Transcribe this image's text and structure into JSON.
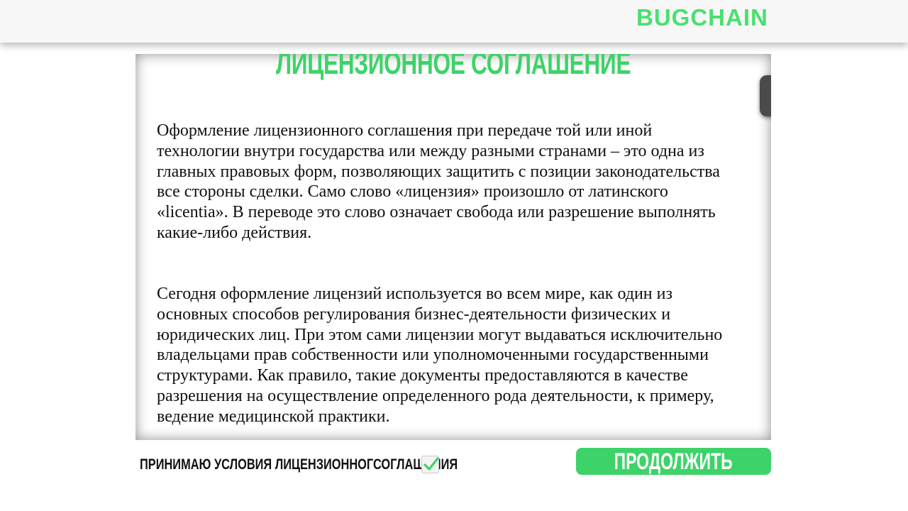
{
  "header": {
    "logo": "BUGCHAIN"
  },
  "document": {
    "title": "ЛИЦЕНЗИОННОЕ СОГЛАШЕНИЕ",
    "paragraphs": [
      "Оформление лицензионного соглашения при передаче той или иной технологии внутри государства или между разными странами – это одна из главных правовых форм, позволяющих защитить с позиции законодательства все стороны сделки. Само слово «лицензия» произошло от латинского «licentia». В переводе это слово означает свобода или разрешение выполнять какие-либо действия.",
      "Сегодня оформление лицензий используется во всем мире, как один из основных способов регулирования бизнес-деятельности физических и юридических лиц. При этом сами лицензии могут выдаваться исключительно владельцами прав собственности или уполномоченными государственными структурами. Как правило, такие документы предоставляются в качестве разрешения на осуществление определенного рода деятельности, к примеру, ведение медицинской практики."
    ]
  },
  "footer": {
    "accept_label": "ПРИНИМАЮ УСЛОВИЯ ЛИЦЕНЗИОННОГСОГЛАШЕНИЯ",
    "accept_checked": true,
    "continue_label": "ПРОДОЛЖИТЬ"
  },
  "colors": {
    "accent": "#3dd368",
    "logo": "#49e06f",
    "header_bg": "#f7f7f7"
  }
}
